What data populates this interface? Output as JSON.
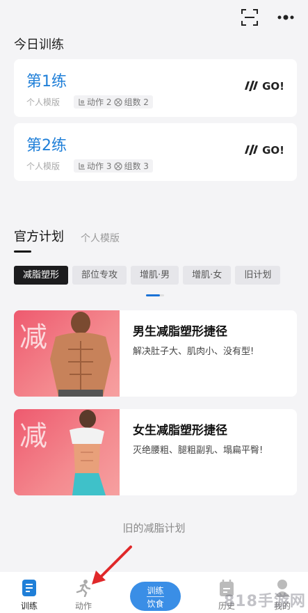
{
  "today": {
    "title": "今日训练"
  },
  "plans": [
    {
      "name": "第1练",
      "template": "个人模版",
      "actions": "动作 2",
      "sets": "组数 2",
      "go": "GO!"
    },
    {
      "name": "第2练",
      "template": "个人模版",
      "actions": "动作 3",
      "sets": "组数 3",
      "go": "GO!"
    }
  ],
  "tabs": {
    "official": "官方计划",
    "personal": "个人模版"
  },
  "chips": [
    "减脂塑形",
    "部位专攻",
    "增肌·男",
    "增肌·女",
    "旧计划"
  ],
  "courses": [
    {
      "badge": "减",
      "title": "男生减脂塑形捷径",
      "desc": "解决肚子大、肌肉小、没有型!"
    },
    {
      "badge": "减",
      "title": "女生减脂塑形捷径",
      "desc": "灭绝腰粗、腿粗副乳、塌扁平臀!"
    }
  ],
  "old_plans": "旧的减脂计划",
  "nav": {
    "train": "训练",
    "actions": "动作",
    "center_top": "训练",
    "center_bottom": "饮食",
    "history": "历史",
    "mine": "我的"
  },
  "watermark": "818手游网",
  "colors": {
    "accent": "#1f7fd8",
    "nav_center": "#3a8ee6",
    "card_image": "#ee5a6f",
    "arrow": "#e0282a"
  }
}
